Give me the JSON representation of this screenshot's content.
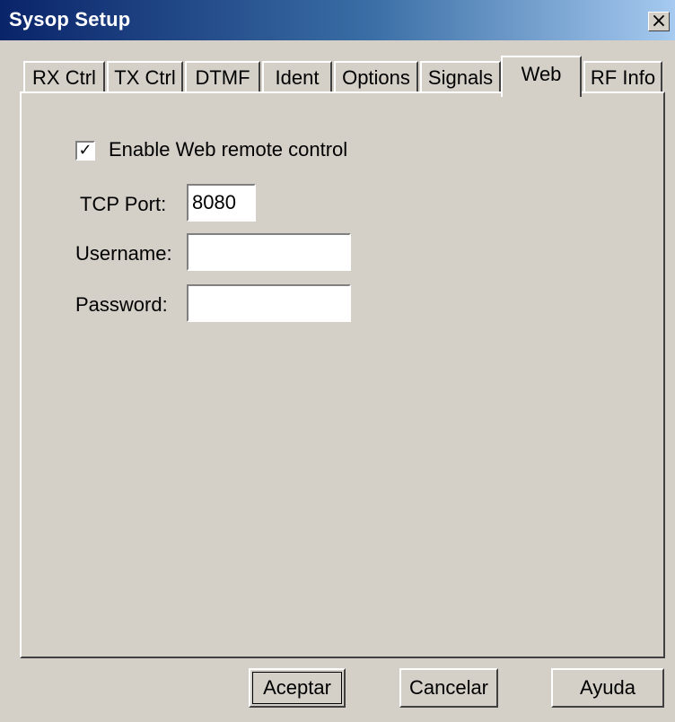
{
  "window": {
    "title": "Sysop Setup"
  },
  "tabs": [
    {
      "label": "RX Ctrl",
      "active": false
    },
    {
      "label": "TX Ctrl",
      "active": false
    },
    {
      "label": "DTMF",
      "active": false
    },
    {
      "label": "Ident",
      "active": false
    },
    {
      "label": "Options",
      "active": false
    },
    {
      "label": "Signals",
      "active": false
    },
    {
      "label": "Web",
      "active": true
    },
    {
      "label": "RF Info",
      "active": false
    }
  ],
  "web": {
    "enable_label": "Enable Web remote control",
    "enable_checked": true,
    "tcp_port_label": "TCP Port:",
    "tcp_port_value": "8080",
    "username_label": "Username:",
    "username_value": "",
    "password_label": "Password:",
    "password_value": ""
  },
  "buttons": {
    "ok": "Aceptar",
    "cancel": "Cancelar",
    "help": "Ayuda"
  },
  "colors": {
    "titlebar_start": "#0a246a",
    "titlebar_end": "#a6caf0",
    "face": "#d4d0c8"
  },
  "icons": {
    "close": "close-icon",
    "check": "check-icon"
  }
}
